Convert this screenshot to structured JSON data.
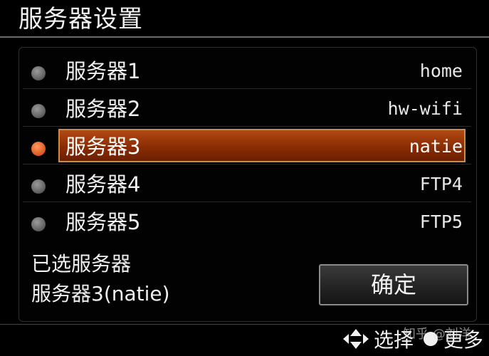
{
  "header": {
    "title": "服务器设置"
  },
  "servers": [
    {
      "name": "服务器1",
      "value": "home"
    },
    {
      "name": "服务器2",
      "value": "hw-wifi"
    },
    {
      "name": "服务器3",
      "value": "natie"
    },
    {
      "name": "服务器4",
      "value": "FTP4"
    },
    {
      "name": "服务器5",
      "value": "FTP5"
    }
  ],
  "selection": {
    "label": "已选服务器",
    "value": "服务器3(natie)"
  },
  "confirm": {
    "label": "确定"
  },
  "footer": {
    "select_label": "选择",
    "more_label": "更多"
  },
  "watermark": {
    "text": "知乎 @刘洋"
  },
  "colors": {
    "highlight": "#8a2c04",
    "highlight_border": "#d08a4a",
    "selected_radio": "#e4642a",
    "unselected_radio": "#6a6a6a",
    "background": "#000000"
  },
  "icons": {
    "select": "up-down-arrows-icon",
    "more": "filled-circle-icon"
  }
}
